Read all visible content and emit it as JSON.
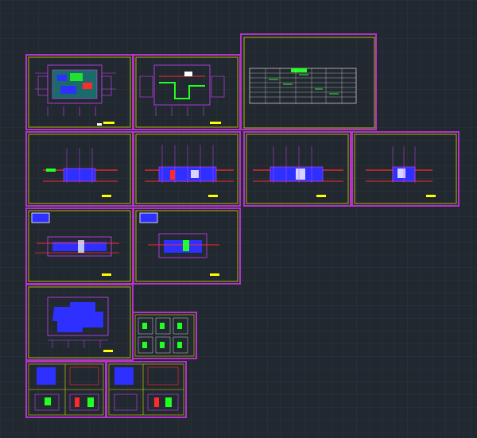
{
  "app": {
    "view": "cad-model-space"
  },
  "colors": {
    "background": "#212830",
    "grid": "#2f3942",
    "sheet_border_outer": "#b432c8",
    "sheet_border_inner": "#d6d600",
    "drawing_magenta": "#d040ff",
    "drawing_red": "#ff2a2a",
    "drawing_green": "#22ff22",
    "drawing_blue": "#2d30ff",
    "drawing_white": "#ffffff",
    "drawing_yellow": "#ffff00",
    "drawing_cyan": "#20d0ff"
  },
  "sheets": [
    {
      "id": "plan-1",
      "type": "plan"
    },
    {
      "id": "plan-2",
      "type": "plan"
    },
    {
      "id": "schedule",
      "type": "table"
    },
    {
      "id": "elev-1",
      "type": "elevation"
    },
    {
      "id": "elev-2",
      "type": "elevation"
    },
    {
      "id": "elev-3",
      "type": "elevation"
    },
    {
      "id": "elev-4",
      "type": "elevation"
    },
    {
      "id": "section-1",
      "type": "section"
    },
    {
      "id": "section-2",
      "type": "section"
    },
    {
      "id": "ceiling-plan",
      "type": "plan"
    },
    {
      "id": "detail-grid",
      "type": "details"
    },
    {
      "id": "detail-a",
      "type": "details"
    },
    {
      "id": "detail-b",
      "type": "details"
    }
  ]
}
